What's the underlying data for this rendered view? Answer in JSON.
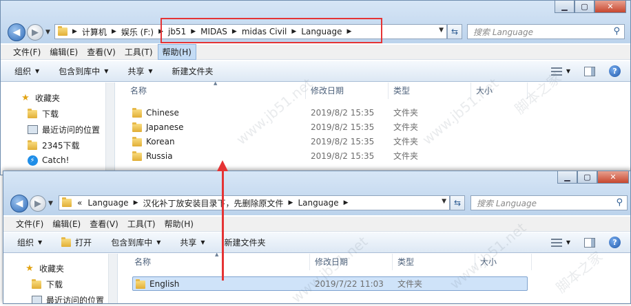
{
  "top_window": {
    "address_crumbs": [
      "计算机",
      "娱乐 (F:)",
      "jb51",
      "MIDAS",
      "midas Civil",
      "Language"
    ],
    "search_placeholder": "搜索 Language",
    "menu": [
      "文件(F)",
      "编辑(E)",
      "查看(V)",
      "工具(T)",
      "帮助(H)"
    ],
    "menu_highlighted": "帮助(H)",
    "commands": [
      "组织",
      "包含到库中",
      "共享",
      "新建文件夹"
    ],
    "nav": [
      "收藏夹",
      "下载",
      "最近访问的位置",
      "2345下载",
      "Catch!"
    ],
    "columns": [
      "名称",
      "修改日期",
      "类型",
      "大小"
    ],
    "files": [
      {
        "name": "Chinese",
        "date": "2019/8/2 15:35",
        "type": "文件夹"
      },
      {
        "name": "Japanese",
        "date": "2019/8/2 15:35",
        "type": "文件夹"
      },
      {
        "name": "Korean",
        "date": "2019/8/2 15:35",
        "type": "文件夹"
      },
      {
        "name": "Russia",
        "date": "2019/8/2 15:35",
        "type": "文件夹"
      }
    ]
  },
  "bottom_window": {
    "address_prefix": "«",
    "address_crumbs": [
      "Language",
      "汉化补丁放安装目录下，先删除原文件",
      "Language"
    ],
    "search_placeholder": "搜索 Language",
    "menu": [
      "文件(F)",
      "编辑(E)",
      "查看(V)",
      "工具(T)",
      "帮助(H)"
    ],
    "commands": [
      "组织",
      "打开",
      "包含到库中",
      "共享",
      "新建文件夹"
    ],
    "nav": [
      "收藏夹",
      "下载",
      "最近访问的位置"
    ],
    "columns": [
      "名称",
      "修改日期",
      "类型",
      "大小"
    ],
    "files": [
      {
        "name": "English",
        "date": "2019/7/22 11:03",
        "type": "文件夹",
        "selected": true
      }
    ]
  },
  "watermark": "www.jb51.net",
  "watermark_site": "脚本之家",
  "colors": {
    "annotation": "#e53334",
    "selection": "#cfe3f9",
    "frame": "#c9dcf0"
  }
}
